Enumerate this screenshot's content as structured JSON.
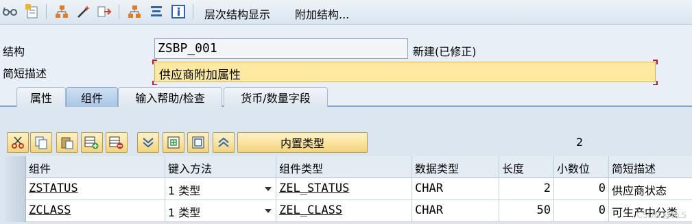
{
  "toolbar": {
    "menu_hierarchy": "层次结构显示",
    "menu_append": "附加结构...",
    "icons": [
      "glasses-icon",
      "edit-toggle-icon",
      "where-used-icon",
      "magic-wand-icon",
      "activate-icon",
      "hierarchy-icon",
      "align-icon",
      "info-icon"
    ]
  },
  "header": {
    "structure_label": "结构",
    "structure_value": "ZSBP_001",
    "structure_status": "新建(已修正)",
    "desc_label": "简短描述",
    "desc_value": "供应商附加属性"
  },
  "tabs": [
    {
      "label": "属性",
      "active": false
    },
    {
      "label": "组件",
      "active": true
    },
    {
      "label": "输入帮助/检查",
      "active": false
    },
    {
      "label": "货币/数量字段",
      "active": false
    }
  ],
  "grid_toolbar": {
    "builtin_type_label": "内置类型",
    "count": "2",
    "icons": [
      "cut-icon",
      "copy-icon",
      "paste-icon",
      "insert-row-icon",
      "delete-row-icon",
      "select-all-icon",
      "details-icon",
      "insert-field-icon",
      "collapse-icon"
    ]
  },
  "table": {
    "columns": [
      "组件",
      "键入方法",
      "组件类型",
      "数据类型",
      "长度",
      "小数位",
      "简短描述"
    ],
    "rows": [
      {
        "component": "ZSTATUS",
        "typing": "1 类型",
        "comp_type": "ZEL_STATUS",
        "data_type": "CHAR",
        "length": "2",
        "decimals": "0",
        "desc": "供应商状态"
      },
      {
        "component": "ZCLASS",
        "typing": "1 类型",
        "comp_type": "ZEL_CLASS",
        "data_type": "CHAR",
        "length": "50",
        "decimals": "0",
        "desc": "可生产中分类"
      }
    ]
  },
  "watermark": "CSDN @BLS",
  "colors": {
    "highlight_field": "#fee9a0",
    "active_tab": "#a9c6e5",
    "button_yellow": "#f4d47a"
  }
}
